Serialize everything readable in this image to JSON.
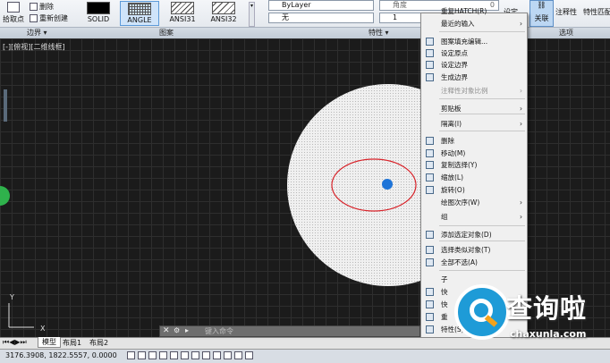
{
  "ribbon": {
    "pick_point": "拾取点",
    "delete": "删除",
    "recreate": "重新创建",
    "patterns": [
      "SOLID",
      "ANGLE",
      "ANSI31",
      "ANSI32"
    ],
    "bylayer": "ByLayer",
    "none": "无",
    "layer_value": "1",
    "transparency_label": "角度",
    "transparency_value": "0",
    "setorigin": "设定",
    "assoc": "关联",
    "annotative": "注释性",
    "match": "特性匹配",
    "panels": {
      "boundary": "边界 ▾",
      "pattern": "图案",
      "properties": "特性 ▾",
      "options": "选项"
    }
  },
  "viewport_label": "[-][俯视][二维线框]",
  "context_menu": {
    "items": [
      {
        "label": "重复HATCH(R)",
        "arrow": ""
      },
      {
        "label": "最近的输入",
        "arrow": "›"
      },
      {
        "label": "图案填充编辑...",
        "arrow": ""
      },
      {
        "label": "设定原点",
        "arrow": ""
      },
      {
        "label": "设定边界",
        "arrow": ""
      },
      {
        "label": "生成边界",
        "arrow": ""
      },
      {
        "label": "注释性对象比例",
        "arrow": "›"
      },
      {
        "label": "剪贴板",
        "arrow": "›"
      },
      {
        "label": "隔离(I)",
        "arrow": "›"
      },
      {
        "label": "删除",
        "arrow": ""
      },
      {
        "label": "移动(M)",
        "arrow": ""
      },
      {
        "label": "复制选择(Y)",
        "arrow": ""
      },
      {
        "label": "缩放(L)",
        "arrow": ""
      },
      {
        "label": "旋转(O)",
        "arrow": ""
      },
      {
        "label": "绘图次序(W)",
        "arrow": "›"
      },
      {
        "label": "组",
        "arrow": "›"
      },
      {
        "label": "添加选定对象(D)",
        "arrow": ""
      },
      {
        "label": "选择类似对象(T)",
        "arrow": ""
      },
      {
        "label": "全部不选(A)",
        "arrow": ""
      },
      {
        "label": "子",
        "arrow": ""
      },
      {
        "label": "快",
        "arrow": ""
      },
      {
        "label": "快",
        "arrow": ""
      },
      {
        "label": "重",
        "arrow": ""
      },
      {
        "label": "特性(S)",
        "arrow": ""
      },
      {
        "label": "快捷特性",
        "arrow": ""
      }
    ]
  },
  "command_placeholder": "键入命令",
  "layout_tabs": [
    "模型",
    "布局1",
    "布局2"
  ],
  "status_coords": "3176.3908, 1822.5557, 0.0000",
  "watermark": {
    "main": "查询啦",
    "sub": "chaxunla.com"
  },
  "colors": {
    "accent": "#0078d7",
    "grip": "#1e74d8",
    "hatch": "#f0f0f0"
  }
}
